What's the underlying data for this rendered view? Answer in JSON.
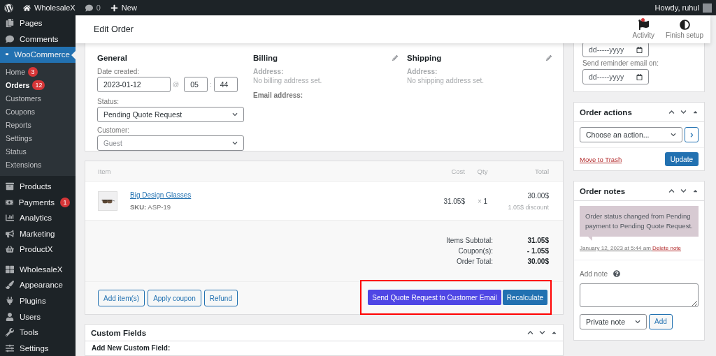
{
  "admin_bar": {
    "site": "WholesaleX",
    "comments": "0",
    "new": "New",
    "greeting": "Howdy, ruhul"
  },
  "sidebar": {
    "items": [
      {
        "label": "Pages",
        "selected": false
      },
      {
        "label": "Comments",
        "selected": false
      },
      {
        "label": "WooCommerce",
        "selected": true,
        "children": [
          {
            "label": "Home",
            "badge": "3",
            "selected": false
          },
          {
            "label": "Orders",
            "badge": "12",
            "selected": true
          },
          {
            "label": "Customers",
            "selected": false
          },
          {
            "label": "Coupons",
            "selected": false
          },
          {
            "label": "Reports",
            "selected": false
          },
          {
            "label": "Settings",
            "selected": false
          },
          {
            "label": "Status",
            "selected": false
          },
          {
            "label": "Extensions",
            "selected": false
          }
        ]
      },
      {
        "label": "Products",
        "selected": false
      },
      {
        "label": "Payments",
        "badge": "1",
        "selected": false
      },
      {
        "label": "Analytics",
        "selected": false
      },
      {
        "label": "Marketing",
        "selected": false
      },
      {
        "label": "ProductX",
        "selected": false
      },
      {
        "label": "WholesaleX",
        "selected": false
      },
      {
        "label": "Appearance",
        "selected": false
      },
      {
        "label": "Plugins",
        "selected": false
      },
      {
        "label": "Users",
        "selected": false
      },
      {
        "label": "Tools",
        "selected": false
      },
      {
        "label": "Settings",
        "selected": false
      }
    ]
  },
  "header": {
    "title": "Edit Order",
    "actions": [
      {
        "label": "Activity",
        "unread": true
      },
      {
        "label": "Finish setup",
        "unread": false
      }
    ]
  },
  "order": {
    "general": {
      "heading": "General",
      "date_label": "Date created:",
      "date": "2023-01-12",
      "at": "@",
      "hour": "05",
      "colon": ":",
      "minute": "44",
      "status_label": "Status:",
      "status": "Pending Quote Request",
      "customer_label": "Customer:",
      "customer_placeholder": "Guest"
    },
    "billing": {
      "heading": "Billing",
      "address_label": "Address:",
      "address": "No billing address set.",
      "email_label": "Email address:"
    },
    "shipping": {
      "heading": "Shipping",
      "address_label": "Address:",
      "address": "No shipping address set."
    }
  },
  "items": {
    "columns": [
      "Item",
      "Cost",
      "Qty",
      "Total"
    ],
    "rows": [
      {
        "name": "Big Design Glasses",
        "sku_label": "SKU:",
        "sku": "ASP-19",
        "cost": "31.05$",
        "qty_sign": "×",
        "qty": "1",
        "total": "30.00$",
        "discount": "1.05$ discount"
      }
    ],
    "totals": [
      {
        "label": "Items Subtotal:",
        "value": "31.05$"
      },
      {
        "label": "Coupon(s):",
        "value": "- 1.05$"
      },
      {
        "label": "Order Total:",
        "value": "30.00$"
      }
    ],
    "left_buttons": [
      "Add item(s)",
      "Apply coupon",
      "Refund"
    ],
    "right_buttons": [
      {
        "label": "Send Quote Request to Customer Email",
        "kind": "quote"
      },
      {
        "label": "Recalculate",
        "kind": "primary"
      }
    ],
    "highlighted": true
  },
  "custom_fields": {
    "heading": "Custom Fields",
    "label": "Add New Custom Field:"
  },
  "reminder": {
    "date_placeholder": "dd-----yyyy",
    "label": "Send reminder email on:",
    "reminder_placeholder": "dd-----yyyy"
  },
  "order_actions": {
    "title": "Order actions",
    "select": "Choose an action...",
    "trash": "Move to Trash",
    "update": "Update"
  },
  "order_notes": {
    "title": "Order notes",
    "notes": [
      {
        "text": "Order status changed from Pending payment to Pending Quote Request.",
        "date": "January 12, 2023 at 5:44 am",
        "delete": "Delete note"
      }
    ],
    "add_label": "Add note",
    "note_type": "Private note",
    "add": "Add"
  }
}
